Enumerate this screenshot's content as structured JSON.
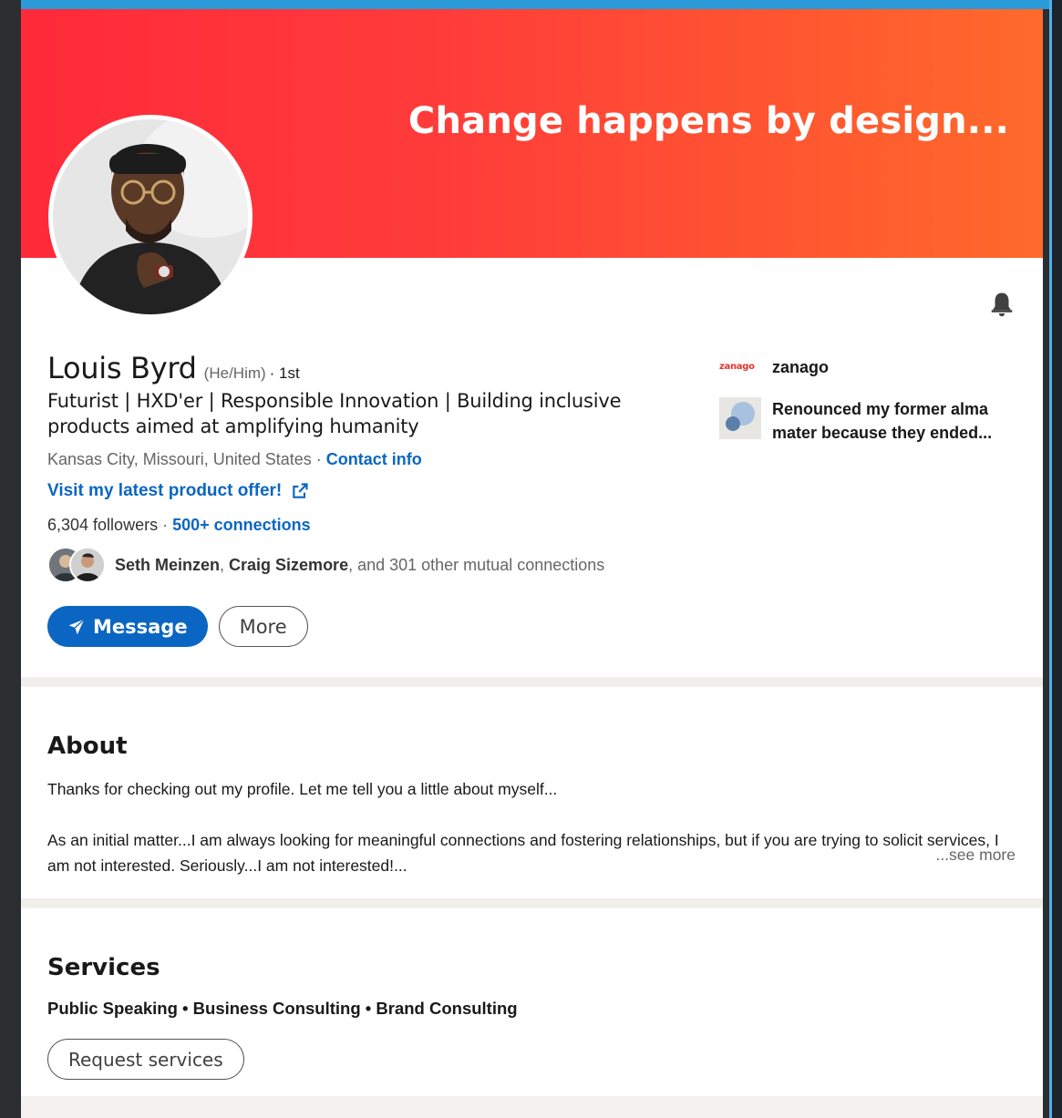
{
  "banner": {
    "text": "Change happens by design..."
  },
  "profile": {
    "name": "Louis Byrd",
    "pronouns": "(He/Him)",
    "degree": "· 1st",
    "headline": "Futurist | HXD'er | Responsible Innovation | Building inclusive products aimed at amplifying humanity",
    "location": "Kansas City, Missouri, United States",
    "location_sep": " · ",
    "contact_info": "Contact info",
    "product_link": "Visit my latest product offer!",
    "followers": "6,304 followers",
    "connections_sep": " · ",
    "connections": "500+ connections",
    "mutual": {
      "name1": "Seth Meinzen",
      "sep": ", ",
      "name2": "Craig Sizemore",
      "rest": ", and 301 other mutual connections"
    }
  },
  "actions": {
    "message": "Message",
    "more": "More"
  },
  "side": {
    "company_logo": "zanago",
    "company_name": "zanago",
    "education": "Renounced my former alma mater because they ended..."
  },
  "about": {
    "title": "About",
    "p1": "Thanks for checking out my profile. Let me tell you a little about myself...",
    "p2": "As an initial matter...I am always looking for meaningful connections and fostering relationships, but if you are trying to solicit services, I am not interested. Seriously...I am not interested!...",
    "see_more": "...see more"
  },
  "services": {
    "title": "Services",
    "list": "Public Speaking • Business Consulting • Brand Consulting",
    "request": "Request services"
  },
  "colors": {
    "accent": "#0a66c2",
    "banner_start": "#ff2a3a",
    "banner_end": "#ff6a2b"
  },
  "icons": {
    "bell": "bell-icon",
    "send": "send-icon",
    "external": "external-link-icon"
  }
}
